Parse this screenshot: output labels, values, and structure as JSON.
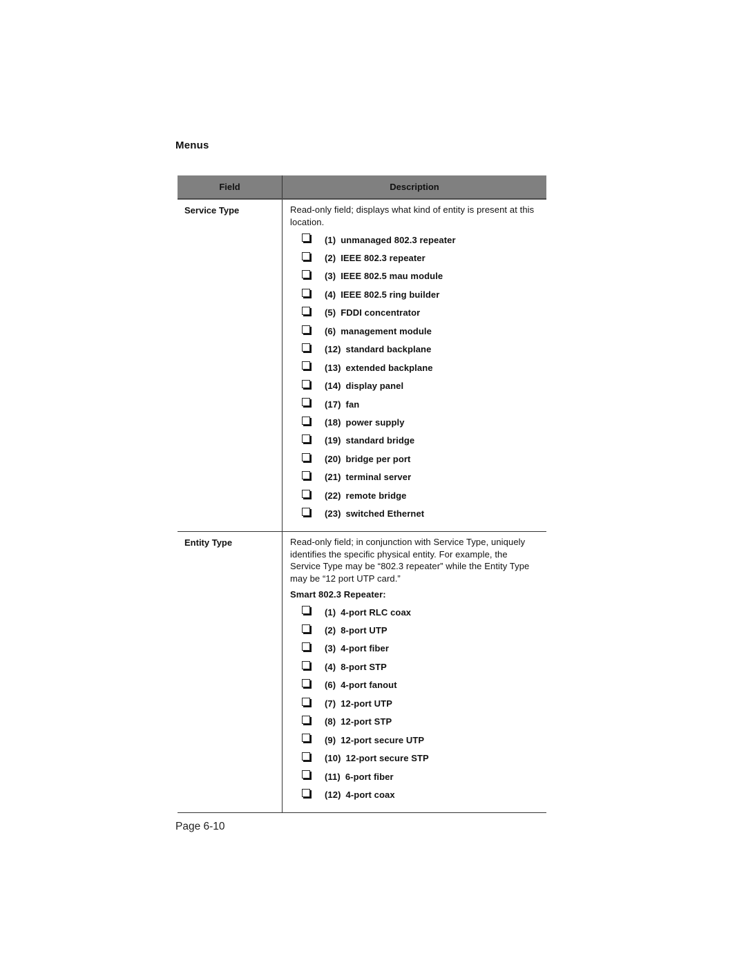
{
  "section_title": "Menus",
  "table": {
    "headers": {
      "field": "Field",
      "description": "Description"
    },
    "rows": [
      {
        "field": "Service Type",
        "description": "Read-only field; displays what kind of entity is present at this location.",
        "subheading": null,
        "options": [
          {
            "num": "(1)",
            "label": "unmanaged 802.3 repeater"
          },
          {
            "num": "(2)",
            "label": "IEEE 802.3 repeater"
          },
          {
            "num": "(3)",
            "label": "IEEE 802.5 mau module"
          },
          {
            "num": "(4)",
            "label": "IEEE 802.5 ring builder"
          },
          {
            "num": "(5)",
            "label": "FDDI concentrator"
          },
          {
            "num": "(6)",
            "label": "management module"
          },
          {
            "num": "(12)",
            "label": "standard backplane"
          },
          {
            "num": "(13)",
            "label": "extended backplane"
          },
          {
            "num": "(14)",
            "label": "display panel"
          },
          {
            "num": "(17)",
            "label": "fan"
          },
          {
            "num": "(18)",
            "label": "power supply"
          },
          {
            "num": "(19)",
            "label": "standard bridge"
          },
          {
            "num": "(20)",
            "label": "bridge per port"
          },
          {
            "num": "(21)",
            "label": "terminal server"
          },
          {
            "num": "(22)",
            "label": "remote bridge"
          },
          {
            "num": "(23)",
            "label": "switched Ethernet"
          }
        ]
      },
      {
        "field": "Entity Type",
        "description": "Read-only field; in conjunction with Service Type, uniquely identifies the specific physical entity.  For example, the Service Type may be “802.3 repeater” while the Entity Type may be “12 port UTP card.”",
        "subheading": "Smart 802.3 Repeater:",
        "options": [
          {
            "num": "(1)",
            "label": "4-port RLC coax"
          },
          {
            "num": "(2)",
            "label": "8-port UTP"
          },
          {
            "num": "(3)",
            "label": "4-port fiber"
          },
          {
            "num": "(4)",
            "label": "8-port STP"
          },
          {
            "num": "(6)",
            "label": "4-port fanout"
          },
          {
            "num": "(7)",
            "label": "12-port UTP"
          },
          {
            "num": "(8)",
            "label": "12-port STP"
          },
          {
            "num": "(9)",
            "label": "12-port secure UTP"
          },
          {
            "num": "(10)",
            "label": "12-port secure STP"
          },
          {
            "num": "(11)",
            "label": "6-port fiber"
          },
          {
            "num": "(12)",
            "label": "4-port coax"
          }
        ]
      }
    ]
  },
  "footer": {
    "page_label": "Page 6-10"
  },
  "colors": {
    "header_bg": "#808080",
    "rule": "#333333",
    "text": "#111111"
  }
}
